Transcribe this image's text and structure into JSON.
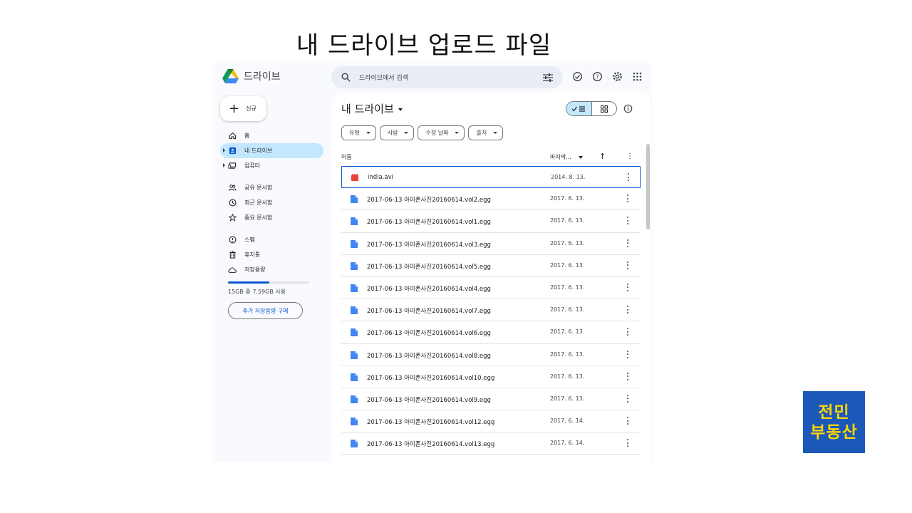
{
  "slide": {
    "title": "내 드라이브 업로드 파일"
  },
  "app": {
    "name": "드라이브"
  },
  "search": {
    "placeholder": "드라이브에서 검색"
  },
  "new_button": {
    "label": "신규"
  },
  "sidebar": {
    "items": [
      {
        "label": "홈",
        "icon": "home-icon",
        "active": false
      },
      {
        "label": "내 드라이브",
        "icon": "my-drive-icon",
        "active": true
      },
      {
        "label": "컴퓨터",
        "icon": "computer-icon",
        "active": false
      },
      {
        "label": "공유 문서함",
        "icon": "shared-icon",
        "active": false
      },
      {
        "label": "최근 문서함",
        "icon": "recent-icon",
        "active": false
      },
      {
        "label": "중요 문서함",
        "icon": "starred-icon",
        "active": false
      },
      {
        "label": "스팸",
        "icon": "spam-icon",
        "active": false
      },
      {
        "label": "휴지통",
        "icon": "trash-icon",
        "active": false
      },
      {
        "label": "저장용량",
        "icon": "cloud-icon",
        "active": false
      }
    ],
    "storage": {
      "text": "15GB 중 7.59GB 사용",
      "used_fraction": 0.506
    },
    "buy_label": "추가 저장용량 구매"
  },
  "main": {
    "title": "내 드라이브",
    "filters": [
      "유형",
      "사람",
      "수정 날짜",
      "출처"
    ],
    "columns": {
      "name": "이름",
      "modified": "마지막..."
    },
    "files": [
      {
        "name": "india.avi",
        "date": "2014. 8. 13.",
        "type": "video",
        "selected": true
      },
      {
        "name": "2017-06-13 아이폰사진20160614.vol2.egg",
        "date": "2017. 6. 13.",
        "type": "doc"
      },
      {
        "name": "2017-06-13 아이폰사진20160614.vol1.egg",
        "date": "2017. 6. 13.",
        "type": "doc"
      },
      {
        "name": "2017-06-13 아이폰사진20160614.vol3.egg",
        "date": "2017. 6. 13.",
        "type": "doc"
      },
      {
        "name": "2017-06-13 아이폰사진20160614.vol5.egg",
        "date": "2017. 6. 13.",
        "type": "doc"
      },
      {
        "name": "2017-06-13 아이폰사진20160614.vol4.egg",
        "date": "2017. 6. 13.",
        "type": "doc"
      },
      {
        "name": "2017-06-13 아이폰사진20160614.vol7.egg",
        "date": "2017. 6. 13.",
        "type": "doc"
      },
      {
        "name": "2017-06-13 아이폰사진20160614.vol6.egg",
        "date": "2017. 6. 13.",
        "type": "doc"
      },
      {
        "name": "2017-06-13 아이폰사진20160614.vol8.egg",
        "date": "2017. 6. 13.",
        "type": "doc"
      },
      {
        "name": "2017-06-13 아이폰사진20160614.vol10.egg",
        "date": "2017. 6. 13.",
        "type": "doc"
      },
      {
        "name": "2017-06-13 아이폰사진20160614.vol9.egg",
        "date": "2017. 6. 13.",
        "type": "doc"
      },
      {
        "name": "2017-06-13 아이폰사진20160614.vol12.egg",
        "date": "2017. 6. 14.",
        "type": "doc"
      },
      {
        "name": "2017-06-13 아이폰사진20160614.vol13.egg",
        "date": "2017. 6. 14.",
        "type": "doc"
      }
    ]
  },
  "badge": {
    "line1": "전민",
    "line2": "부동산"
  },
  "colors": {
    "accent": "#0b57d0",
    "active_bg": "#c2e7ff",
    "badge_bg": "#1c58b8",
    "badge_text": "#ffd600",
    "video_icon": "#ea4335",
    "doc_icon": "#4285f4"
  }
}
